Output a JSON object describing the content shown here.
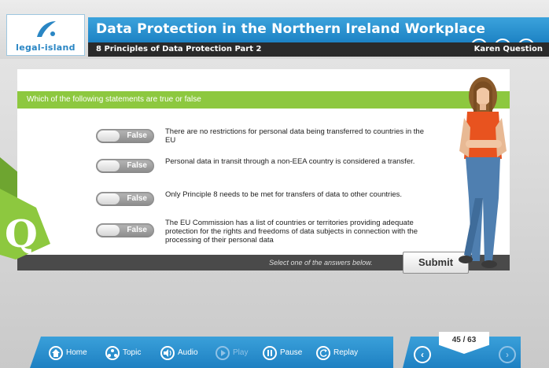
{
  "header": {
    "logo_text": "legal-island",
    "course_title": "Data Protection in the Northern Ireland Workplace",
    "subtitle": "8 Principles of Data Protection Part 2",
    "user": "Karen Question",
    "icons": [
      "accessibility-icon",
      "help-icon",
      "power-icon"
    ],
    "icon_glyphs": {
      "help": "?"
    }
  },
  "question": {
    "prompt": "Which of the following statements are true or false",
    "marker": "Q",
    "statements": [
      {
        "toggle": "False",
        "text": "There are no restrictions for personal data being transferred to countries in the EU"
      },
      {
        "toggle": "False",
        "text": "Personal data in transit through a non-EEA country is considered a transfer."
      },
      {
        "toggle": "False",
        "text": "Only Principle 8 needs to be met for transfers of data to other countries."
      },
      {
        "toggle": "False",
        "text": "The EU Commission has a list of countries or territories providing adequate protection for the rights and freedoms of data subjects in connection with the processing of their personal data"
      }
    ],
    "hint": "Select one of the answers below.",
    "submit_label": "Submit"
  },
  "nav": {
    "items": [
      {
        "label": "Home",
        "icon": "home-icon",
        "enabled": true
      },
      {
        "label": "Topic",
        "icon": "topic-icon",
        "enabled": true
      },
      {
        "label": "Audio",
        "icon": "audio-icon",
        "enabled": true
      },
      {
        "label": "Play",
        "icon": "play-icon",
        "enabled": false
      },
      {
        "label": "Pause",
        "icon": "pause-icon",
        "enabled": true
      },
      {
        "label": "Replay",
        "icon": "replay-icon",
        "enabled": true
      }
    ],
    "page": "45 / 63",
    "prev_icon": "chevron-left-icon",
    "next_icon": "chevron-right-icon",
    "next_enabled": false
  },
  "colors": {
    "brand_blue": "#1d82c4",
    "accent_green": "#8dc83f",
    "dark_bar": "#2a2a2a"
  }
}
